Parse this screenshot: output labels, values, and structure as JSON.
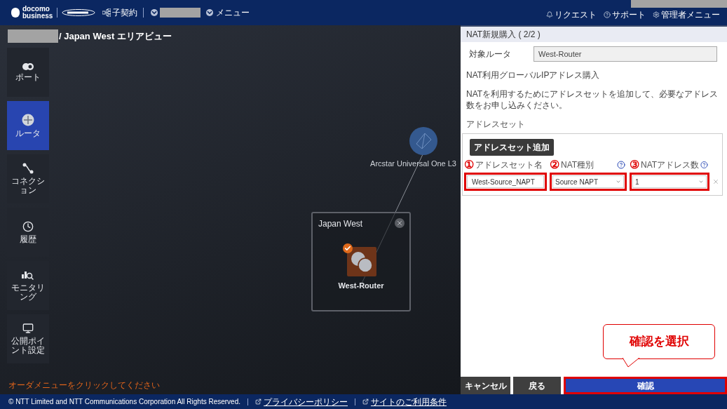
{
  "header": {
    "brand": [
      "docomo",
      "business"
    ],
    "nav": [
      {
        "label": "子契約"
      },
      {
        "label": "メニュー"
      }
    ],
    "links": [
      "リクエスト",
      "サポート",
      "管理者メニュー"
    ]
  },
  "breadcrumb": "/ Japan West エリアビュー",
  "sidebar": {
    "items": [
      {
        "label": "ポート",
        "selected": false
      },
      {
        "label": "ルータ",
        "selected": true
      },
      {
        "label": "コネクション",
        "selected": false
      },
      {
        "label": "履歴",
        "selected": false
      },
      {
        "label": "モニタリング",
        "selected": false
      },
      {
        "label": "公開ポイント設定",
        "selected": false
      }
    ]
  },
  "canvas": {
    "cloud_label": "Arcstar Universal One L3",
    "area_title": "Japan West",
    "router": {
      "label": "West-Router",
      "checked": true
    },
    "hint": "オーダメニューをクリックしてください"
  },
  "panel": {
    "title": "NAT新規購入 ( 2/2 )",
    "target_label": "対象ルータ",
    "target_value": "West-Router",
    "section_title": "NAT利用グローバルIPアドレス購入",
    "description": "NATを利用するためにアドレスセットを追加して、必要なアドレス数をお申し込みください。",
    "address_set_label": "アドレスセット",
    "add_button": "アドレスセット追加",
    "columns": [
      {
        "label": "アドレスセット名",
        "marker": "①",
        "help": false
      },
      {
        "label": "NAT種別",
        "marker": "②",
        "help": true
      },
      {
        "label": "NATアドレス数",
        "marker": "③",
        "help": true
      }
    ],
    "rows": [
      {
        "name": "West-Source_NAPT",
        "nat_type": "Source NAPT",
        "count": "1"
      }
    ],
    "buttons": [
      {
        "label": "キャンセル",
        "kind": "cancel",
        "highlighted": false
      },
      {
        "label": "戻る",
        "kind": "back",
        "highlighted": false
      },
      {
        "label": "確認",
        "kind": "confirm",
        "highlighted": true
      }
    ],
    "callout": "確認を選択"
  },
  "footer": {
    "copyright": "© NTT Limited and NTT Communications Corporation All Rights Reserved.",
    "links": [
      "プライバシーポリシー",
      "サイトのご利用条件"
    ]
  }
}
